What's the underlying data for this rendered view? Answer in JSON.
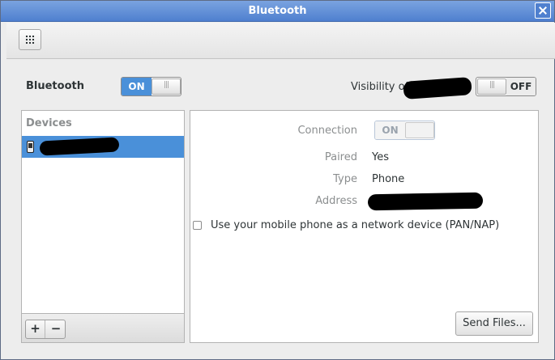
{
  "window": {
    "title": "Bluetooth"
  },
  "toolbar": {
    "grid_icon": "show-applications-icon"
  },
  "bluetooth": {
    "label": "Bluetooth",
    "switch_on": "ON",
    "state": "on"
  },
  "visibility": {
    "label": "Visibility of “",
    "switch_off": "OFF",
    "state": "off"
  },
  "devices": {
    "header": "Devices",
    "add_label": "+",
    "remove_label": "−"
  },
  "details": {
    "connection_label": "Connection",
    "connection_switch": "ON",
    "paired_label": "Paired",
    "paired_value": "Yes",
    "type_label": "Type",
    "type_value": "Phone",
    "address_label": "Address",
    "network_checkbox_label": "Use your mobile phone as a network device (PAN/NAP)",
    "send_files_label": "Send Files..."
  },
  "colors": {
    "accent": "#4a90d9",
    "titlebar": "#5b8bd6"
  }
}
